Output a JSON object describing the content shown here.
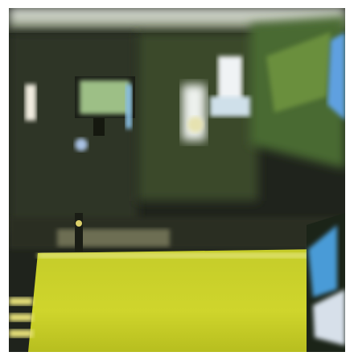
{
  "scene": {
    "kind": "photo",
    "caption": "",
    "colors": {
      "counter": "#c9cf2a",
      "counter_shade": "#a9b01c",
      "wall_dark": "#1d211b",
      "floor_edge": "#e8e27a",
      "sky_blue": "#3a8fd8",
      "screen_green": "#8fb87a",
      "monitor_white": "#eef2f4"
    }
  }
}
